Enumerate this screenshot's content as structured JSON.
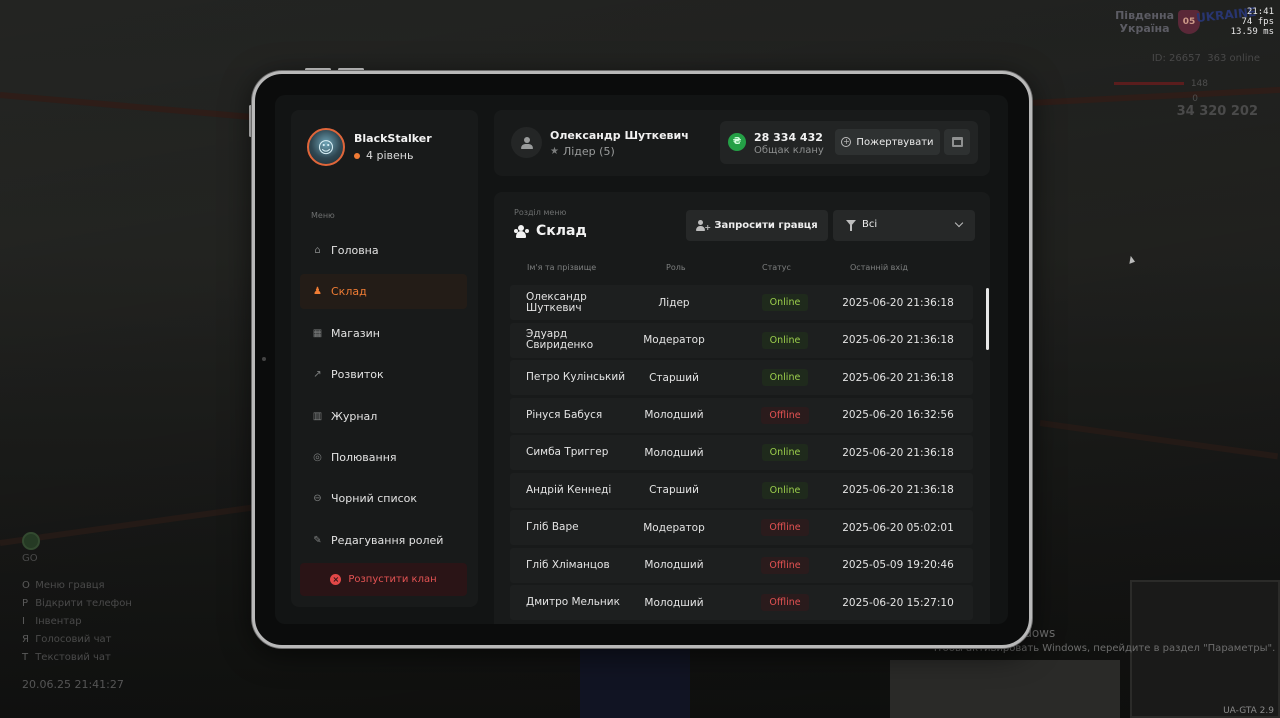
{
  "hud": {
    "region_line1": "Південна",
    "region_line2": "Україна",
    "server_badge": "05",
    "server_logo": "UKRAINE",
    "time": "21:41",
    "fps": "74 fps",
    "ping": "13.59 ms",
    "player_id": "ID: 26657",
    "online": "363 online",
    "health": "148",
    "armor": "0",
    "money": "34 320 202",
    "radio_label": "GO",
    "hints": [
      {
        "key": "O",
        "label": "Меню гравця"
      },
      {
        "key": "P",
        "label": "Відкрити телефон"
      },
      {
        "key": "I",
        "label": "Інвентар"
      },
      {
        "key": "Я",
        "label": "Голосовий чат"
      },
      {
        "key": "T",
        "label": "Текстовий чат"
      }
    ],
    "datetime": "20.06.25 21:41:27",
    "activation_title": "Активация Windows",
    "activation_text": "Чтобы активировать Windows, перейдите в раздел \"Параметры\".",
    "version": "UA-GTA 2.9"
  },
  "profile": {
    "name": "BlackStalker",
    "level": "4 рівень"
  },
  "sidebar": {
    "menu_caption": "Меню",
    "items": [
      {
        "label": "Головна",
        "icon": "home-icon",
        "glyph": "⌂"
      },
      {
        "label": "Склад",
        "icon": "members-icon",
        "glyph": "♟",
        "active": true
      },
      {
        "label": "Магазин",
        "icon": "shop-icon",
        "glyph": "▦"
      },
      {
        "label": "Розвиток",
        "icon": "chart-icon",
        "glyph": "↗"
      },
      {
        "label": "Журнал",
        "icon": "journal-icon",
        "glyph": "▥"
      },
      {
        "label": "Полювання",
        "icon": "target-icon",
        "glyph": "◎"
      },
      {
        "label": "Чорний список",
        "icon": "blacklist-icon",
        "glyph": "⊖"
      },
      {
        "label": "Редагування ролей",
        "icon": "role-edit-icon",
        "glyph": "✎"
      }
    ],
    "dissolve_label": "Розпустити клан"
  },
  "header": {
    "leader_name": "Олександр Шуткевич",
    "leader_role": "Лідер (5)",
    "treasury_amount": "28 334 432",
    "treasury_label": "Общак клану",
    "donate_label": "Пожертвувати"
  },
  "members": {
    "caption": "Розділ меню",
    "title": "Склад",
    "invite_label": "Запросити гравця",
    "filter_value": "Всі",
    "columns": {
      "name": "Ім'я та прізвище",
      "role": "Роль",
      "status": "Статус",
      "last": "Останній вхід"
    },
    "rows": [
      {
        "name": "Олександр Шуткевич",
        "role": "Лідер",
        "status": "Online",
        "last": "2025-06-20 21:36:18"
      },
      {
        "name": "Эдуард Свириденко",
        "role": "Модератор",
        "status": "Online",
        "last": "2025-06-20 21:36:18"
      },
      {
        "name": "Петро Кулінський",
        "role": "Старший",
        "status": "Online",
        "last": "2025-06-20 21:36:18"
      },
      {
        "name": "Рінуся Бабуся",
        "role": "Молодший",
        "status": "Offline",
        "last": "2025-06-20 16:32:56"
      },
      {
        "name": "Симба Триггер",
        "role": "Молодший",
        "status": "Online",
        "last": "2025-06-20 21:36:18"
      },
      {
        "name": "Андрій Кеннеді",
        "role": "Старший",
        "status": "Online",
        "last": "2025-06-20 21:36:18"
      },
      {
        "name": "Гліб Варе",
        "role": "Модератор",
        "status": "Offline",
        "last": "2025-06-20 05:02:01"
      },
      {
        "name": "Гліб Хліманцов",
        "role": "Молодший",
        "status": "Offline",
        "last": "2025-05-09 19:20:46"
      },
      {
        "name": "Дмитро Мельник",
        "role": "Молодший",
        "status": "Offline",
        "last": "2025-06-20 15:27:10"
      }
    ]
  },
  "colors": {
    "accent": "#ef7c34",
    "online": "#9ccf4c",
    "offline": "#e25252",
    "money": "#24a046"
  }
}
